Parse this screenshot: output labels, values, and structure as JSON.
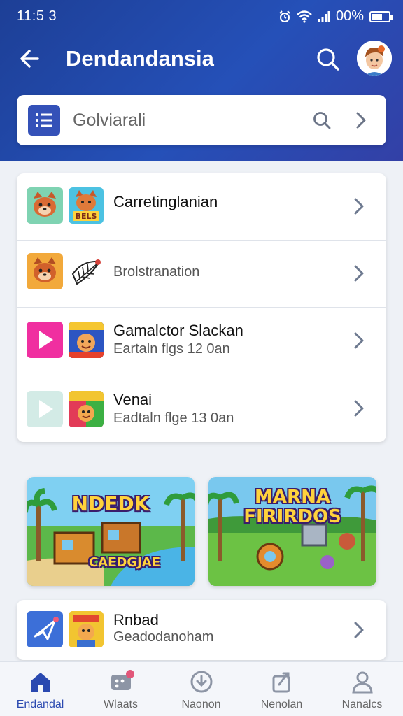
{
  "status": {
    "time": "11:5 3",
    "battery": "00%"
  },
  "header": {
    "title": "Dendandansia"
  },
  "search": {
    "placeholder": "Golviarali"
  },
  "list": [
    {
      "title": "Carretinglanian",
      "subtitle": ""
    },
    {
      "title": "",
      "subtitle": "Brolstranation"
    },
    {
      "title": "Gamalctor Slackan",
      "subtitle": "Eartaln flgs 12 0an"
    },
    {
      "title": "Venai",
      "subtitle": "Eadtaln flge 13 0an"
    }
  ],
  "thumbs": {
    "row1": "BELS"
  },
  "banners": [
    {
      "title": "NDEDK",
      "caption": "CAEDGJAE"
    },
    {
      "title_line1": "MARNA",
      "title_line2": "FIRIRDOS"
    }
  ],
  "bottom_item": {
    "title": "Rnbad",
    "subtitle": "Geadodanoham"
  },
  "nav": [
    {
      "label": "Endandal",
      "icon": "home-icon",
      "active": true
    },
    {
      "label": "Wlaats",
      "icon": "game-icon",
      "active": false
    },
    {
      "label": "Naonon",
      "icon": "download-icon",
      "active": false
    },
    {
      "label": "Nenolan",
      "icon": "share-icon",
      "active": false
    },
    {
      "label": "Nanalcs",
      "icon": "profile-icon",
      "active": false
    }
  ],
  "colors": {
    "header": "#2550b8",
    "accent": "#3451b8",
    "pink": "#f02fa0"
  }
}
